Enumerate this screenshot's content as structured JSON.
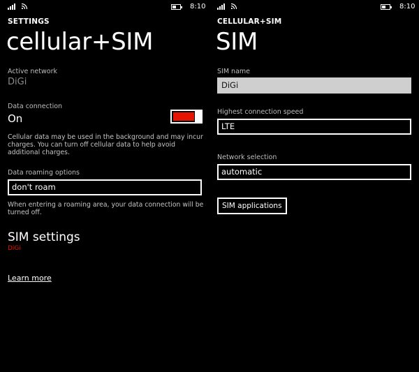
{
  "status": {
    "time": "8:10"
  },
  "left": {
    "app_title": "SETTINGS",
    "page_title": "cellular+SIM",
    "active_network_label": "Active network",
    "active_network_value": "DiGi",
    "data_connection_label": "Data connection",
    "data_connection_value": "On",
    "data_connection_on": true,
    "data_desc": "Cellular data may be used in the background and may incur charges. You can turn off cellular data to help avoid additional charges.",
    "roaming_label": "Data roaming options",
    "roaming_value": "don't roam",
    "roaming_desc": "When entering a roaming area, your data connection will be turned off.",
    "sim_settings_title": "SIM settings",
    "sim_settings_sub": "DiGi",
    "learn_more": "Learn more"
  },
  "right": {
    "app_title": "CELLULAR+SIM",
    "page_title": "SIM",
    "sim_name_label": "SIM name",
    "sim_name_value": "DiGi",
    "speed_label": "Highest connection speed",
    "speed_value": "LTE",
    "network_label": "Network selection",
    "network_value": "automatic",
    "sim_apps_button": "SIM applications"
  },
  "colors": {
    "accent": "#e51400",
    "background": "#000000",
    "foreground": "#ffffff",
    "muted": "#8a8a8a"
  },
  "icons": {
    "signal": "signal-strength-icon",
    "wifi": "wifi-icon",
    "battery": "battery-icon"
  }
}
